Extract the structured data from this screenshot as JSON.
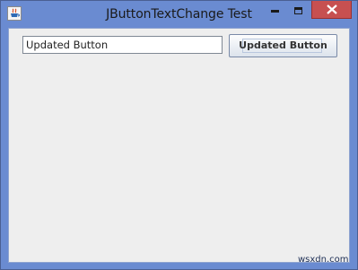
{
  "window": {
    "title": "JButtonTextChange Test"
  },
  "titlebar": {
    "app_icon": "java-coffee-icon",
    "minimize_icon": "minimize-icon",
    "maximize_icon": "maximize-icon",
    "close_icon": "close-icon"
  },
  "form": {
    "text_field_value": "Updated Button",
    "button_label": "Updated Button"
  },
  "watermark": "wsxdn.com",
  "colors": {
    "frame": "#6a8bd1",
    "content_bg": "#eeeeee",
    "close_button": "#c75050"
  }
}
